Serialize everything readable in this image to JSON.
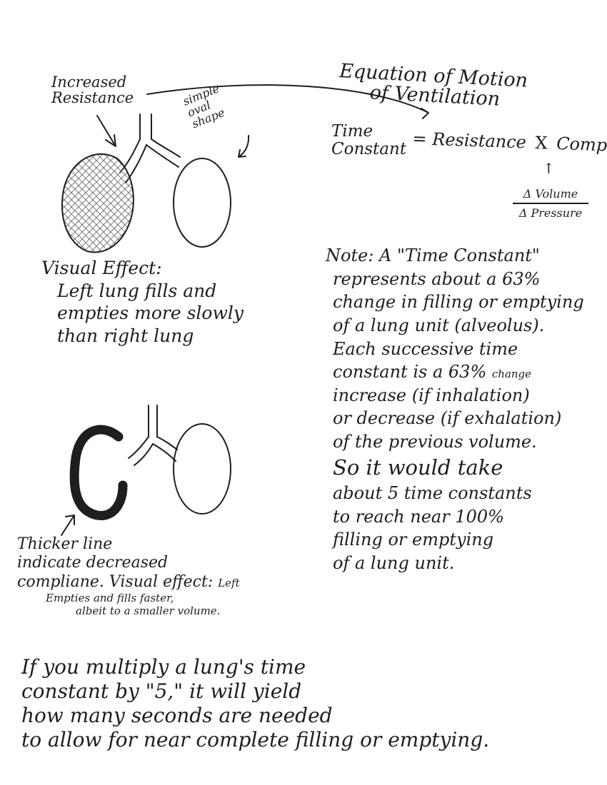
{
  "labels": {
    "increased_resistance": [
      "Increased",
      "Resistance"
    ],
    "oval_shape": [
      "simple",
      "oval",
      "shape"
    ]
  },
  "equation": {
    "title": [
      "Equation of Motion",
      "of Ventilation"
    ],
    "time_constant": [
      "Time",
      "Constant"
    ],
    "equals": "=",
    "resistance": "Resistance",
    "times": "X",
    "compliance": "Compliance",
    "compliance_numerator": "Δ Volume",
    "compliance_denominator": "Δ Pressure"
  },
  "visual_effect_1": [
    "Visual Effect:",
    "Left lung fills and",
    "empties more slowly",
    "than right lung"
  ],
  "note": {
    "lines": [
      "Note: A \"Time Constant\"",
      "represents about a 63%",
      "change in filling or emptying",
      "of a lung unit (alveolus).",
      "Each successive time",
      "constant is a 63%",
      "increase (if inhalation)",
      "or decrease (if exhalation)",
      "of the previous volume.",
      "So it would take",
      "about 5 time constants",
      "to reach near 100%",
      "filling or emptying",
      "of a lung unit."
    ],
    "change_small": "change"
  },
  "compliance_note": {
    "lines": [
      "Thicker line",
      "indicate decreased",
      "compliane. Visual effect:"
    ],
    "left_small": "Left",
    "effect_small": [
      "Empties and fills faster,",
      "albeit to a smaller volume."
    ]
  },
  "bottom_note": [
    "If you multiply a lung's time",
    "constant by \"5,\" it will yield",
    "how many seconds are needed",
    "to allow for near complete filling or emptying."
  ]
}
